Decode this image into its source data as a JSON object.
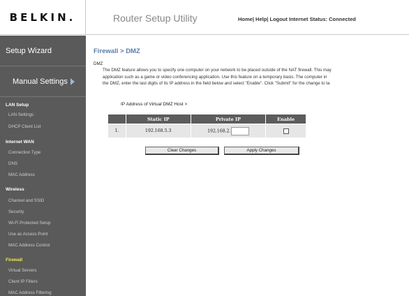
{
  "header": {
    "logo": "BELKIN.",
    "app_title": "Router Setup Utility",
    "links": {
      "home": "Home",
      "help": "Help",
      "logout": "Logout",
      "status": "Internet Status: Connected"
    }
  },
  "sidebar": {
    "setup_wizard": "Setup Wizard",
    "manual_settings": "Manual Settings",
    "sections": [
      {
        "title": "LAN Setup",
        "items": [
          "LAN Settings",
          "DHCP Client List"
        ]
      },
      {
        "title": "Internet WAN",
        "items": [
          "Connection Type",
          "DNS",
          "MAC Address"
        ]
      },
      {
        "title": "Wireless",
        "items": [
          "Channel and SSID",
          "Security",
          "Wi-Fi Protected Setup",
          "Use as Access Point",
          "MAC Address Control"
        ]
      },
      {
        "title": "Firewall",
        "items": [
          "Virtual Servers",
          "Client IP Filters",
          "MAC Address Filtering"
        ]
      }
    ]
  },
  "main": {
    "breadcrumb": "Firewall > DMZ",
    "section_label": "DMZ",
    "description_lines": [
      "The DMZ feature allows you to specify one computer on your network to be placed outside of the NAT firewall. This may",
      "application such as a game or video conferencing application. Use this feature on a temporary basis. The computer in",
      "the DMZ, enter the last digits of its IP address in the field below and select \"Enable\". Click \"Submit\" for the change to ta"
    ],
    "table_heading": "IP Address of Virtual DMZ Host >",
    "table": {
      "headers": [
        "",
        "Static IP",
        "Private IP",
        "Enable"
      ],
      "rows": [
        {
          "num": "1.",
          "static_ip": "192.168.5.3",
          "private_ip_prefix": "192.168.2.",
          "private_ip_value": "",
          "enabled": false
        }
      ]
    },
    "buttons": {
      "clear": "Clear Changes",
      "apply": "Apply Changes"
    }
  }
}
